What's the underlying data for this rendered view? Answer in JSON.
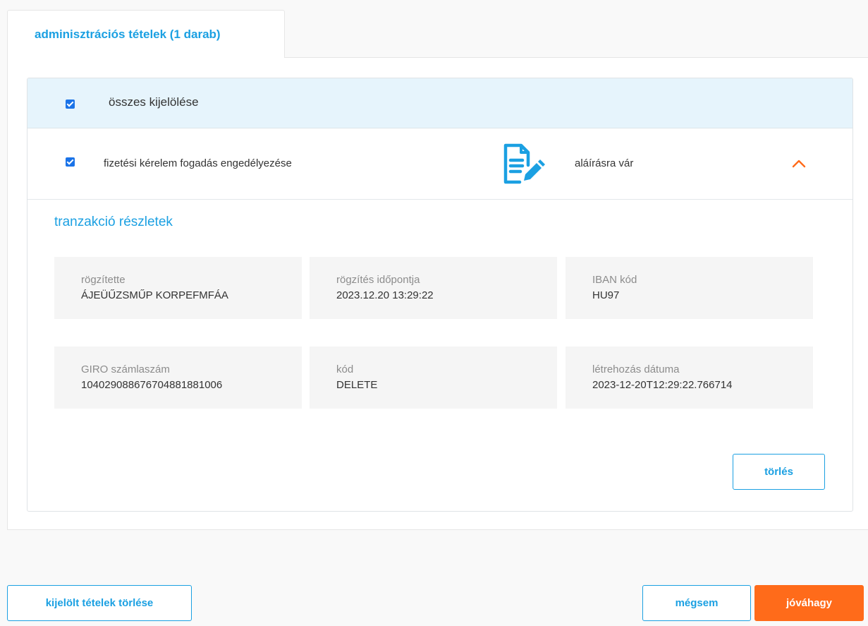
{
  "tab": {
    "label": "adminisztrációs tételek (1 darab)"
  },
  "select_all": {
    "checked": true,
    "label": "összes kijelölése"
  },
  "item": {
    "checked": true,
    "label": "fizetési kérelem fogadás engedélyezése",
    "status_icon": "document-edit-icon",
    "status": "aláírásra vár",
    "toggle_icon": "chevron-up-icon"
  },
  "details": {
    "title": "tranzakció részletek",
    "fields": [
      {
        "label": "rögzítette",
        "value": "ÁJEÜŰZSMŰP KORPEFMFÁA"
      },
      {
        "label": "rögzítés időpontja",
        "value": "2023.12.20 13:29:22"
      },
      {
        "label": "IBAN kód",
        "value": "HU97"
      },
      {
        "label": "GIRO számlaszám",
        "value": "10402908867670488​1881006"
      },
      {
        "label": "kód",
        "value": "DELETE"
      },
      {
        "label": "létrehozás dátuma",
        "value": "2023-12-20T12:29:22.766714"
      }
    ],
    "delete_label": "törlés"
  },
  "footer": {
    "delete_selected_label": "kijelölt tételek törlése",
    "cancel_label": "mégsem",
    "approve_label": "jóváhagy"
  },
  "colors": {
    "accent": "#1ba0e2",
    "primary_button": "#ff6b1a",
    "checkbox": "#1a73e8",
    "select_all_bg": "#e6f4fc",
    "field_bg": "#f5f5f5"
  }
}
